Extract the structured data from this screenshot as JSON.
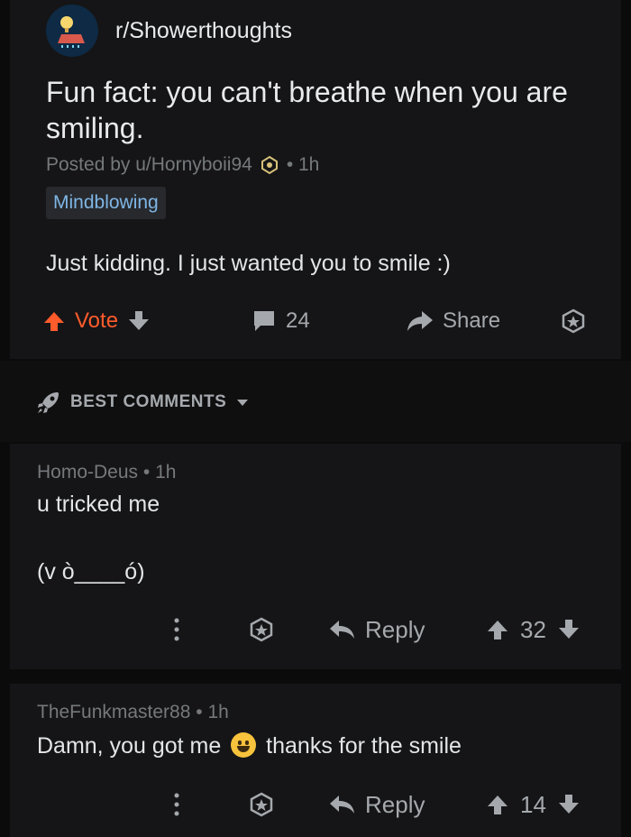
{
  "post": {
    "subreddit": "r/Showerthoughts",
    "title": "Fun fact: you can't breathe when you are smiling.",
    "posted_by": "Posted by u/Hornyboii94",
    "time": "• 1h",
    "flair": "Mindblowing",
    "body": "Just kidding. I just wanted you to smile :)",
    "vote_label": "Vote",
    "comment_count": "24",
    "share_label": "Share"
  },
  "sort": {
    "label": "BEST COMMENTS"
  },
  "comments": [
    {
      "author": "Homo-Deus",
      "time": "• 1h",
      "lines": [
        "u tricked me",
        "(v ò____ó)"
      ],
      "reply_label": "Reply",
      "score": "32"
    },
    {
      "author": "TheFunkmaster88",
      "time": "• 1h",
      "text_before": "Damn, you got me",
      "emoji": "smiling-face",
      "text_after": "thanks for the smile",
      "reply_label": "Reply",
      "score": "14"
    }
  ],
  "colors": {
    "upvote_accent": "#ff5b2b",
    "flair_text": "#7fb6e6",
    "panel_bg": "#151517"
  }
}
